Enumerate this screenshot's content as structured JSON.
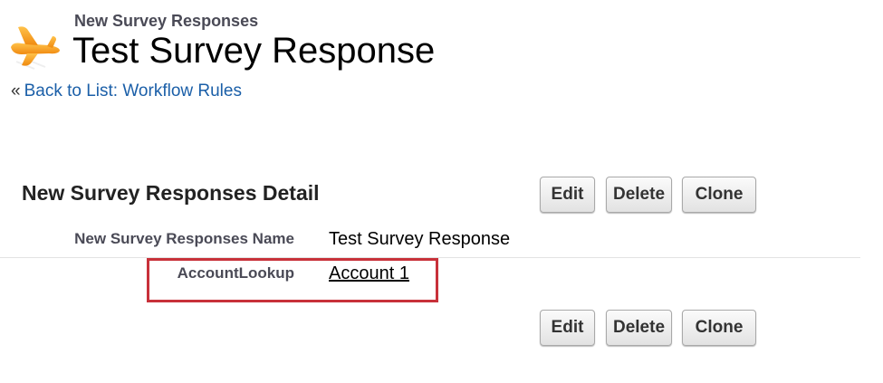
{
  "header": {
    "object_label": "New Survey Responses",
    "record_title": "Test Survey Response",
    "back_prefix": "«",
    "back_link": "Back to List: Workflow Rules",
    "icon": "airplane-icon"
  },
  "detail": {
    "heading": "New Survey Responses Detail",
    "buttons_top": {
      "edit": "Edit",
      "delete": "Delete",
      "clone": "Clone"
    },
    "buttons_bottom": {
      "edit": "Edit",
      "delete": "Delete",
      "clone": "Clone"
    },
    "fields": [
      {
        "label": "New Survey Responses Name",
        "value": "Test Survey Response"
      },
      {
        "label": "AccountLookup",
        "value": "Account 1"
      }
    ]
  },
  "colors": {
    "link": "#1b5fa8",
    "highlight": "#c8313a"
  }
}
